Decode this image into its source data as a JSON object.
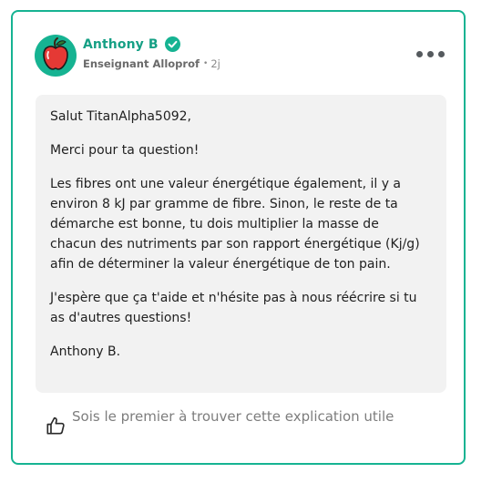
{
  "author": {
    "name": "Anthony B",
    "role": "Enseignant Alloprof",
    "separator": "•",
    "posted": "2j",
    "avatar_icon": "apple-icon",
    "verified_icon": "check-circle-icon"
  },
  "menu": {
    "icon": "more-horizontal-icon"
  },
  "answer": {
    "paragraphs": [
      "Salut TitanAlpha5092,",
      "Merci pour ta question!",
      "Les fibres ont une valeur énergétique également, il y a environ 8 kJ par gramme de fibre. Sinon, le reste de ta démarche est bonne, tu dois multiplier la masse de chacun des nutriments par son rapport énergétique (Kj/g) afin de déterminer la valeur énergétique de ton pain.",
      "J'espère que ça t'aide et n'hésite pas à nous réécrire si tu as d'autres questions!",
      "Anthony B."
    ]
  },
  "helpful": {
    "label": "Sois le premier à trouver cette explication utile",
    "icon": "thumbs-up-icon"
  },
  "colors": {
    "accent": "#16b392",
    "author_name": "#16a085",
    "answer_background": "#f2f2f2",
    "muted_text": "#7d7d7d"
  }
}
